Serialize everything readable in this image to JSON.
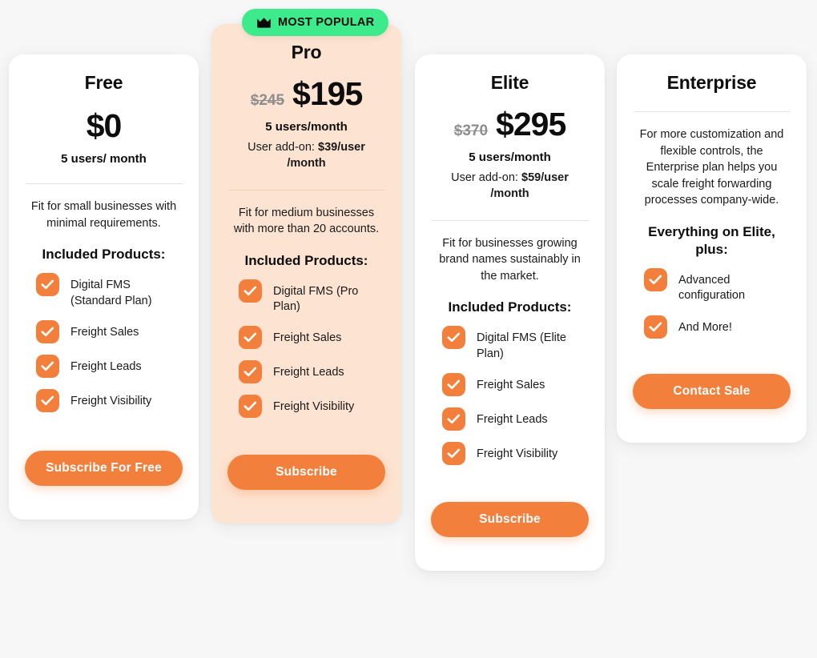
{
  "badge": {
    "label": "MOST POPULAR",
    "icon": "crown-icon",
    "background": "#3EEB8C",
    "text_color": "#0A0A0A"
  },
  "theme": {
    "page_background": "#F7F7F7",
    "accent": "#F2803C",
    "highlight_card_background": "#FDE3D1",
    "card_background": "#FFFFFF",
    "old_price_color": "#8E8E8E"
  },
  "plans": [
    {
      "id": "free",
      "name": "Free",
      "price_old": "",
      "price_now": "$0",
      "users_line": "5 users/ month",
      "addon_line": "",
      "description": "Fit for small businesses with minimal requirements.",
      "features_title": "Included Products:",
      "features": [
        "Digital FMS (Standard Plan)",
        "Freight Sales",
        "Freight Leads",
        "Freight Visibility"
      ],
      "cta_label": "Subscribe For Free"
    },
    {
      "id": "pro",
      "name": "Pro",
      "price_old": "$245",
      "price_now": "$195",
      "users_line": "5 users/month",
      "addon_prefix": "User add-on: ",
      "addon_value": "$39/user /month",
      "description": "Fit for medium businesses with more than 20 accounts.",
      "features_title": "Included Products:",
      "features": [
        "Digital FMS (Pro Plan)",
        "Freight Sales",
        "Freight Leads",
        "Freight Visibility"
      ],
      "cta_label": "Subscribe"
    },
    {
      "id": "elite",
      "name": "Elite",
      "price_old": "$370",
      "price_now": "$295",
      "users_line": "5 users/month",
      "addon_prefix": "User add-on: ",
      "addon_value": "$59/user /month",
      "description": "Fit for businesses growing brand names sustainably in the market.",
      "features_title": "Included Products:",
      "features": [
        "Digital FMS (Elite Plan)",
        "Freight Sales",
        "Freight Leads",
        "Freight Visibility"
      ],
      "cta_label": "Subscribe"
    },
    {
      "id": "enterprise",
      "name": "Enterprise",
      "price_old": "",
      "price_now": "",
      "users_line": "",
      "addon_line": "",
      "description": "For more customization and flexible controls, the Enterprise plan helps you scale freight forwarding processes company-wide.",
      "features_title": "Everything on Elite, plus:",
      "features": [
        "Advanced configuration",
        "And More!"
      ],
      "cta_label": "Contact Sale"
    }
  ]
}
